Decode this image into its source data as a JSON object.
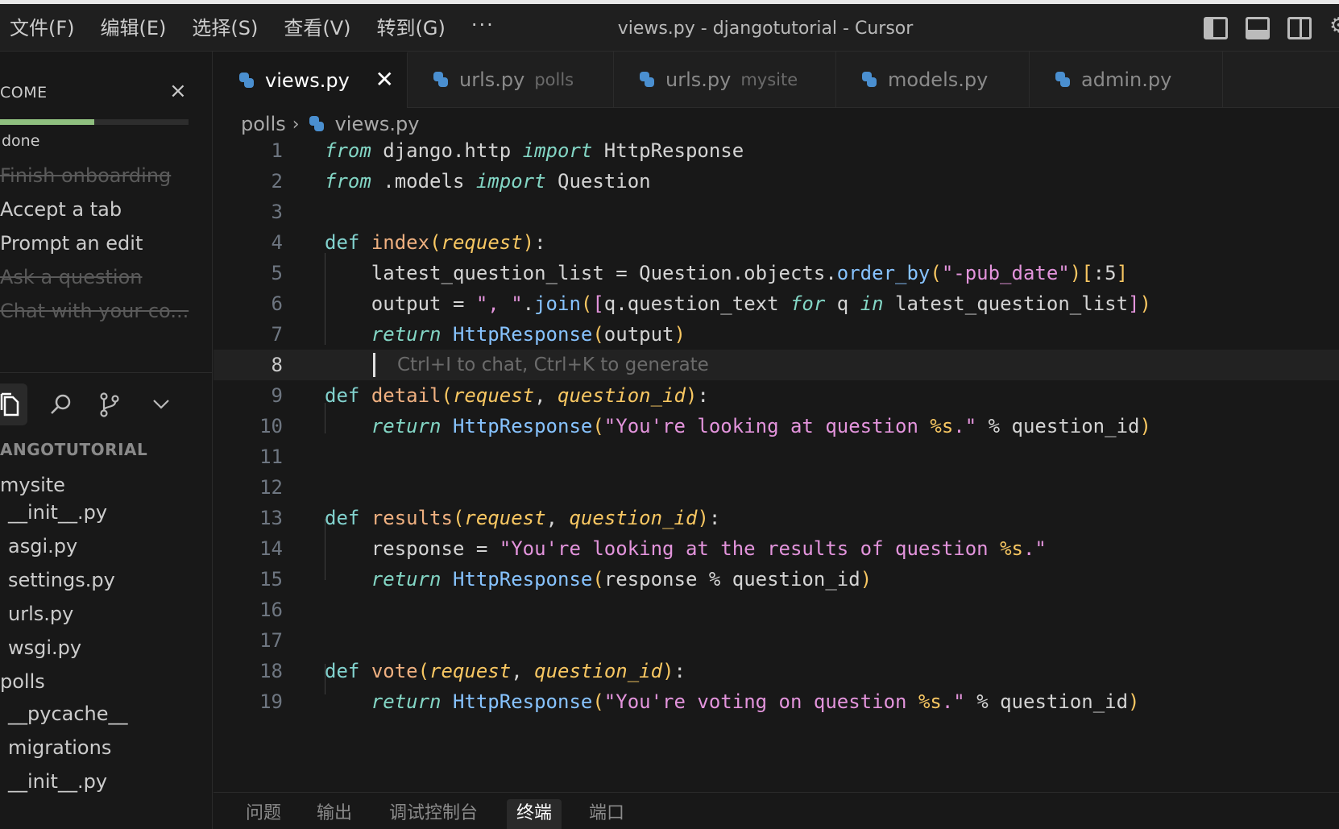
{
  "titlebar": {
    "menu": [
      "文件(F)",
      "编辑(E)",
      "选择(S)",
      "查看(V)",
      "转到(G)"
    ],
    "more": "···",
    "title": "views.py - djangotutorial - Cursor"
  },
  "sidebar": {
    "welcome_title": "COME",
    "progress": 0.5,
    "done_label": "done",
    "tasks": [
      {
        "label": "Finish onboarding",
        "done": true
      },
      {
        "label": "Accept a tab",
        "done": false
      },
      {
        "label": "Prompt an edit",
        "done": false
      },
      {
        "label": "Ask a question",
        "done": true
      },
      {
        "label": "Chat with your co...",
        "done": true
      }
    ],
    "explorer_title": "ANGOTUTORIAL",
    "tree": [
      "mysite",
      "__init__.py",
      "asgi.py",
      "settings.py",
      "urls.py",
      "wsgi.py",
      "polls",
      "__pycache__",
      "migrations",
      "__init__.py"
    ]
  },
  "tabs": [
    {
      "name": "views.py",
      "desc": "",
      "active": true
    },
    {
      "name": "urls.py",
      "desc": "polls",
      "active": false
    },
    {
      "name": "urls.py",
      "desc": "mysite",
      "active": false
    },
    {
      "name": "models.py",
      "desc": "",
      "active": false
    },
    {
      "name": "admin.py",
      "desc": "",
      "active": false
    }
  ],
  "breadcrumb": {
    "folder": "polls",
    "file": "views.py"
  },
  "editor": {
    "current_line": 8,
    "ghost_hint": "Ctrl+I to chat, Ctrl+K to generate",
    "line_numbers": [
      "1",
      "2",
      "3",
      "4",
      "5",
      "6",
      "7",
      "8",
      "9",
      "10",
      "11",
      "12",
      "13",
      "14",
      "15",
      "16",
      "17",
      "18",
      "19"
    ],
    "code_lines": [
      "from django.http import HttpResponse",
      "from .models import Question",
      "",
      "def index(request):",
      "    latest_question_list = Question.objects.order_by(\"-pub_date\")[:5]",
      "    output = \", \".join([q.question_text for q in latest_question_list])",
      "    return HttpResponse(output)",
      "",
      "def detail(request, question_id):",
      "    return HttpResponse(\"You're looking at question %s.\" % question_id)",
      "",
      "",
      "def results(request, question_id):",
      "    response = \"You're looking at the results of question %s.\"",
      "    return HttpResponse(response % question_id)",
      "",
      "",
      "def vote(request, question_id):",
      "    return HttpResponse(\"You're voting on question %s.\" % question_id)"
    ]
  },
  "panel": {
    "tabs": [
      "问题",
      "输出",
      "调试控制台",
      "终端",
      "端口"
    ],
    "active": "终端"
  },
  "colors": {
    "keyword_italic": "#83d6c5",
    "def": "#82d2ce",
    "function": "#efb080",
    "class": "#87c3ff",
    "param": "#f8c762",
    "string": "#e394dc",
    "progress": "#8fbf7f"
  }
}
